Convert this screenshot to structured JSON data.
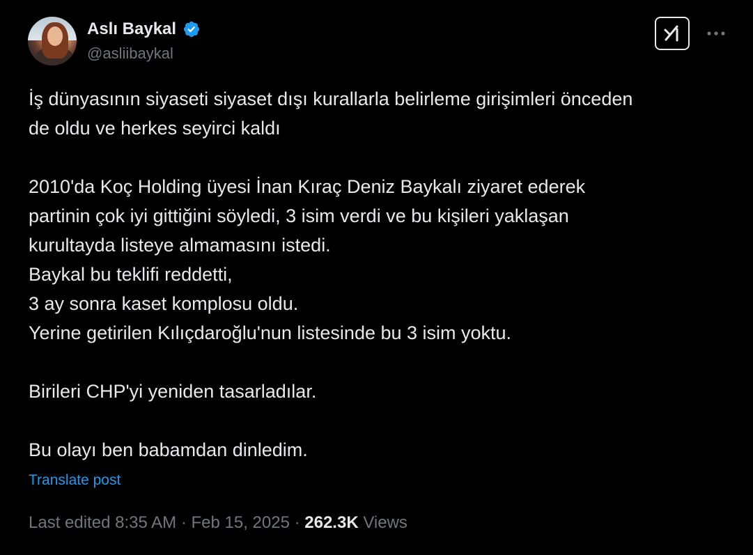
{
  "author": {
    "display_name": "Aslı Baykal",
    "handle": "@asliibaykal",
    "verified": true
  },
  "tweet": {
    "text": "İş dünyasının siyaseti siyaset dışı kurallarla belirleme girişimleri önceden\nde oldu ve herkes seyirci kaldı\n\n2010'da Koç Holding üyesi İnan Kıraç Deniz Baykalı ziyaret ederek\npartinin çok iyi gittiğini söyledi, 3 isim verdi ve bu kişileri yaklaşan\nkurultayda listeye almamasını istedi.\nBaykal bu teklifi reddetti,\n3 ay sonra kaset komplosu oldu.\nYerine getirilen Kılıçdaroğlu'nun listesinde bu 3 isim yoktu.\n\nBirileri CHP'yi yeniden tasarladılar.\n\nBu olayı ben babamdan dinledim.",
    "translate_label": "Translate post"
  },
  "meta": {
    "edited_label": "Last edited 8:35 AM",
    "separator": " · ",
    "date": "Feb 15, 2025",
    "views_count": "262.3K",
    "views_label": "Views"
  },
  "icons": {
    "verified": "verified-badge-icon",
    "grok": "grok-icon",
    "more": "more-horizontal-icon"
  },
  "colors": {
    "background": "#000000",
    "text": "#e7e9ea",
    "secondary": "#71767b",
    "accent": "#1d9bf0"
  }
}
